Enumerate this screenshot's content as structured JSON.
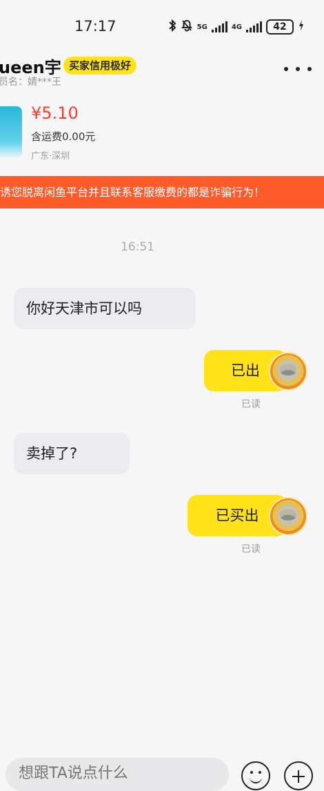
{
  "status_bar": {
    "time": "17:17",
    "network_1": "5G",
    "network_2": "4G",
    "battery": "42"
  },
  "header": {
    "name": "ueen宇",
    "credit_badge": "买家信用极好",
    "member_label": "员名：婧***王"
  },
  "product": {
    "price": "¥5.10",
    "shipping": "含运费0.00元",
    "location": "广东·深圳"
  },
  "warning_banner": "诱您脱离闲鱼平台并且联系客服缴费的都是诈骗行为！",
  "chat": {
    "time": "16:51",
    "messages": [
      {
        "side": "left",
        "text": "你好天津市可以吗"
      },
      {
        "side": "right",
        "text": "已出",
        "read": "已读"
      },
      {
        "side": "left",
        "text": "卖掉了?"
      },
      {
        "side": "right",
        "text": "已买出",
        "read": "已读"
      }
    ]
  },
  "composer": {
    "placeholder": "想跟TA说点什么"
  },
  "icons": {
    "bluetooth": "bluetooth-icon",
    "mute": "mute-bell-icon",
    "signal": "signal-icon",
    "charging": "charging-icon",
    "more": "more-icon",
    "emoji": "emoji-icon",
    "add": "add-icon"
  },
  "colors": {
    "accent": "#ffe318",
    "warning": "#ff5a2a",
    "price": "#ff3b30"
  }
}
